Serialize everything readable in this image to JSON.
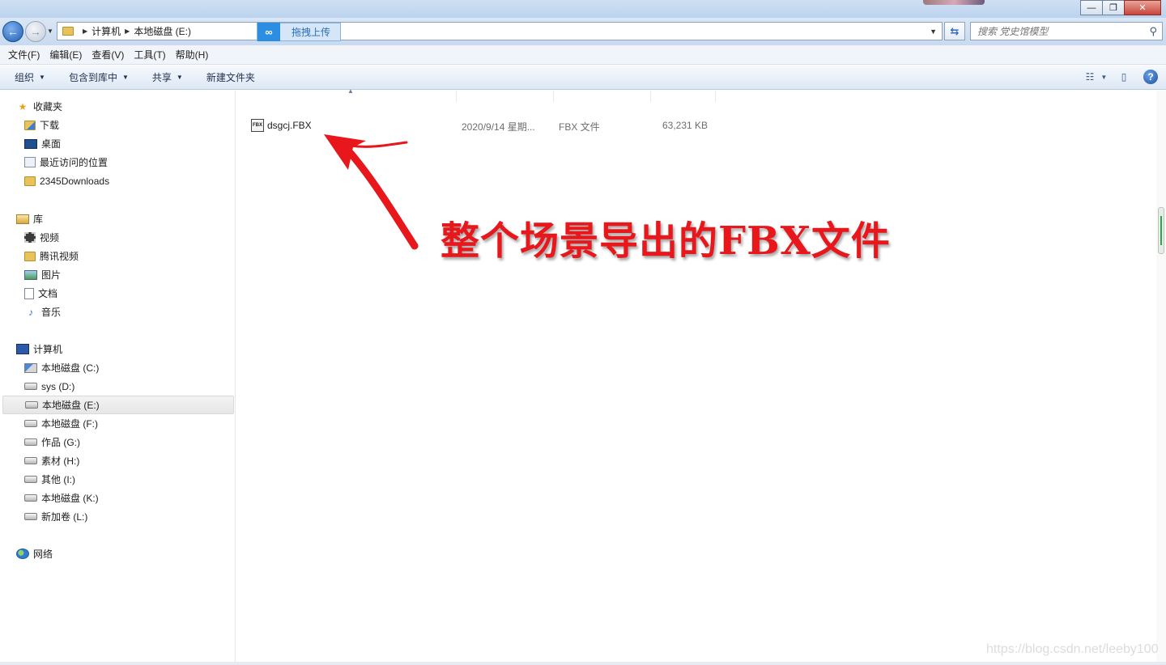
{
  "window": {
    "minimize_glyph": "—",
    "maximize_glyph": "❐",
    "close_glyph": "✕"
  },
  "address": {
    "breadcrumbs": [
      "计算机",
      "本地磁盘 (E:)"
    ],
    "upload_label": "拖拽上传",
    "search_placeholder": "搜索 党史馆模型"
  },
  "menu": [
    "文件(F)",
    "编辑(E)",
    "查看(V)",
    "工具(T)",
    "帮助(H)"
  ],
  "toolbar": {
    "organize": "组织",
    "include_in_library": "包含到库中",
    "share": "共享",
    "new_folder": "新建文件夹"
  },
  "nav": {
    "favorites": {
      "label": "收藏夹",
      "items": [
        "下载",
        "桌面",
        "最近访问的位置",
        "2345Downloads"
      ]
    },
    "libraries": {
      "label": "库",
      "items": [
        "视频",
        "腾讯视频",
        "图片",
        "文档",
        "音乐"
      ]
    },
    "computer": {
      "label": "计算机",
      "items": [
        "本地磁盘 (C:)",
        "sys (D:)",
        "本地磁盘 (E:)",
        "本地磁盘 (F:)",
        "作品 (G:)",
        "素材 (H:)",
        "其他 (I:)",
        "本地磁盘 (K:)",
        "新加卷 (L:)"
      ],
      "selected": "本地磁盘 (E:)"
    },
    "network": {
      "label": "网络"
    }
  },
  "files": [
    {
      "name": "dsgcj.FBX",
      "date": "2020/9/14 星期...",
      "type": "FBX 文件",
      "size": "63,231 KB",
      "icon_text": "FBX"
    }
  ],
  "annotation": {
    "text": "整个场景导出的FBX文件",
    "color": "#e8171c"
  },
  "watermark": "https://blog.csdn.net/leeby100"
}
